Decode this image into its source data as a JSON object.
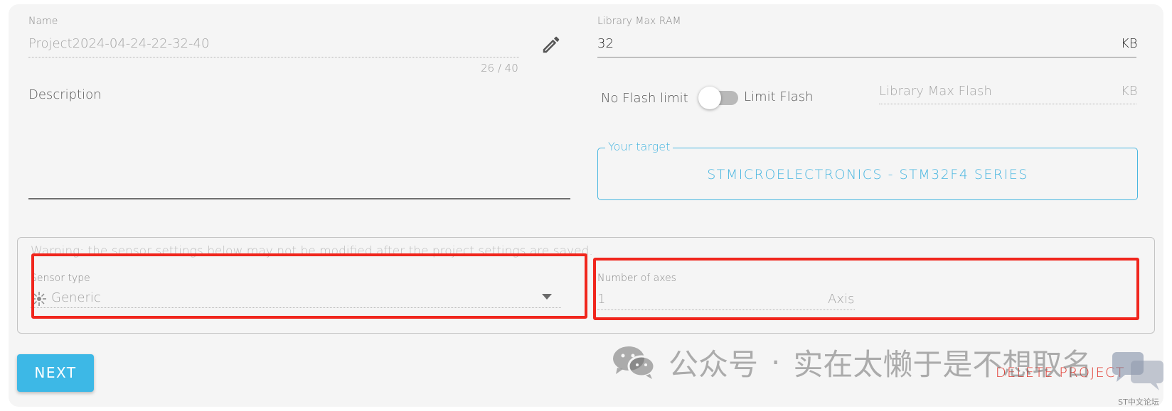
{
  "name_field": {
    "label": "Name",
    "value": "Project2024-04-24-22-32-40",
    "counter": "26 / 40"
  },
  "description_field": {
    "label": "Description"
  },
  "ram_field": {
    "label": "Library Max RAM",
    "value": "32",
    "unit": "KB"
  },
  "flash": {
    "no_limit_label": "No Flash limit",
    "limit_label": "Limit Flash",
    "toggle_on": false,
    "max_flash_placeholder": "Library Max Flash",
    "unit": "KB"
  },
  "target": {
    "legend": "Your target",
    "value": "STMICROELECTRONICS - STM32F4 SERIES"
  },
  "sensor_settings": {
    "warning": "Warning: the sensor settings below may not be modified after the project settings are saved.",
    "sensor_type_label": "Sensor type",
    "sensor_type_value": "Generic",
    "axes_label": "Number of axes",
    "axes_value": "1",
    "axes_unit": "Axis"
  },
  "actions": {
    "next_label": "NEXT",
    "delete_label": "DELETE PROJECT"
  },
  "watermark": {
    "text_prefix": "公众号",
    "separator": "·",
    "text_name": "实在太懒于是不想取名",
    "logo_text": "ST中文论坛"
  },
  "colors": {
    "accent": "#3db8e6",
    "target": "#49b6e0",
    "danger": "#e23c32",
    "highlight_box": "#f0261d",
    "card_bg": "#f5f5f5"
  },
  "icons": [
    "pencil-icon",
    "sensor-icon",
    "dropdown-caret-icon",
    "wechat-icon"
  ]
}
